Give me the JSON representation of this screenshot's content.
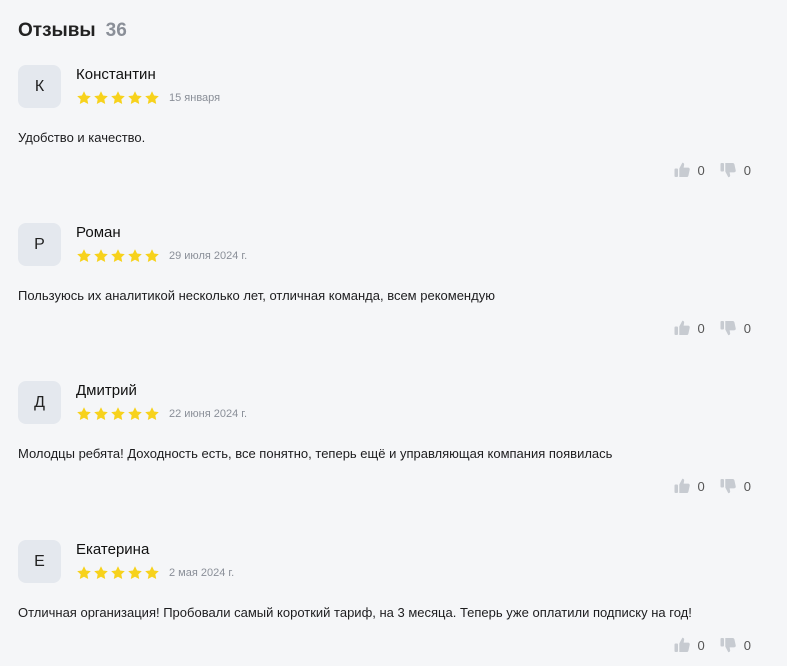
{
  "header": {
    "title": "Отзывы",
    "count": "36"
  },
  "colors": {
    "star": "#f7d21c",
    "thumb": "#c7cbd1"
  },
  "reviews": [
    {
      "initial": "К",
      "name": "Константин",
      "rating": 5,
      "date": "15 января",
      "text": "Удобство и качество.",
      "likes": "0",
      "dislikes": "0"
    },
    {
      "initial": "Р",
      "name": "Роман",
      "rating": 5,
      "date": "29 июля 2024 г.",
      "text": "Пользуюсь их аналитикой несколько лет, отличная команда, всем рекомендую",
      "likes": "0",
      "dislikes": "0"
    },
    {
      "initial": "Д",
      "name": "Дмитрий",
      "rating": 5,
      "date": "22 июня 2024 г.",
      "text": "Молодцы ребята! Доходность есть, все понятно, теперь ещё и управляющая компания появилась",
      "likes": "0",
      "dislikes": "0"
    },
    {
      "initial": "Е",
      "name": "Екатерина",
      "rating": 5,
      "date": "2 мая 2024 г.",
      "text": "Отличная организация! Пробовали самый короткий тариф, на 3 месяца. Теперь уже оплатили подписку на год!",
      "likes": "0",
      "dislikes": "0"
    }
  ]
}
